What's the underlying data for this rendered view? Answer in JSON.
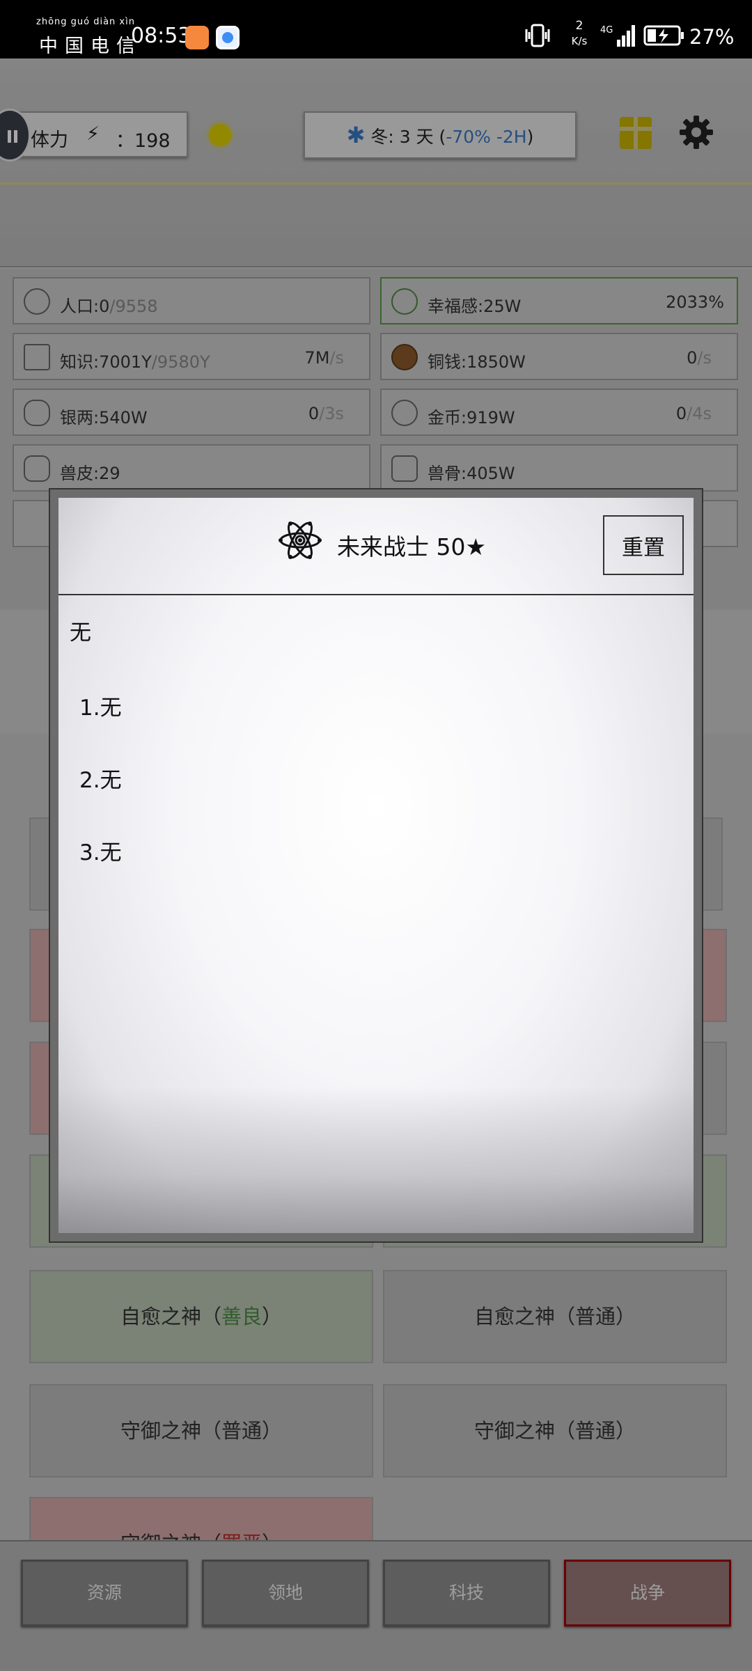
{
  "status_bar": {
    "carrier_pinyin": "zhōng guó diàn xìn",
    "carrier": "中国电信",
    "time": "08:53",
    "net_speed_value": "2",
    "net_speed_unit": "K/s",
    "network": "4G",
    "battery": "27%"
  },
  "header": {
    "stamina_label": "体力",
    "stamina_sep": "：",
    "stamina_value": "198",
    "season": "冬: 3 天 (",
    "season_modifier": "-70% -2H",
    "season_close": ")"
  },
  "resources": [
    {
      "name": "人口:0",
      "dim": "/9558",
      "rate": "",
      "rate_dim": ""
    },
    {
      "name": "幸福感:25W",
      "dim": "",
      "rate": "2033%",
      "rate_dim": ""
    },
    {
      "name": "知识:7001Y",
      "dim": "/9580Y",
      "rate": "7M",
      "rate_dim": "/s"
    },
    {
      "name": "铜钱:1850W",
      "dim": "",
      "rate": "0",
      "rate_dim": "/s"
    },
    {
      "name": "银两:540W",
      "dim": "",
      "rate": "0",
      "rate_dim": "/3s"
    },
    {
      "name": "金币:919W",
      "dim": "",
      "rate": "0",
      "rate_dim": "/4s"
    },
    {
      "name": "兽皮:29",
      "dim": "",
      "rate": "",
      "rate_dim": ""
    },
    {
      "name": "兽骨:405W",
      "dim": "",
      "rate": "",
      "rate_dim": ""
    }
  ],
  "gods": [
    {
      "name": "自愈之神（",
      "tag": "善良",
      "close": "）"
    },
    {
      "name": "自愈之神（普通）",
      "tag": "",
      "close": ""
    },
    {
      "name": "守御之神（普通）",
      "tag": "",
      "close": ""
    },
    {
      "name": "守御之神（普通）",
      "tag": "",
      "close": ""
    },
    {
      "name": "守御之神（",
      "tag": "罪恶",
      "close": "）"
    }
  ],
  "nav": {
    "resources": "资源",
    "territory": "领地",
    "tech": "科技",
    "war": "战争"
  },
  "dialog": {
    "title": "未来战士  50★",
    "reset_label": "重置",
    "heading": "无",
    "items": [
      "1.无",
      "2.无",
      "3.无"
    ]
  },
  "colors": {
    "accent_blue": "#3a78c4",
    "good_green": "#4d8a45",
    "evil_red": "#b3352e",
    "war_border": "#a40000"
  }
}
